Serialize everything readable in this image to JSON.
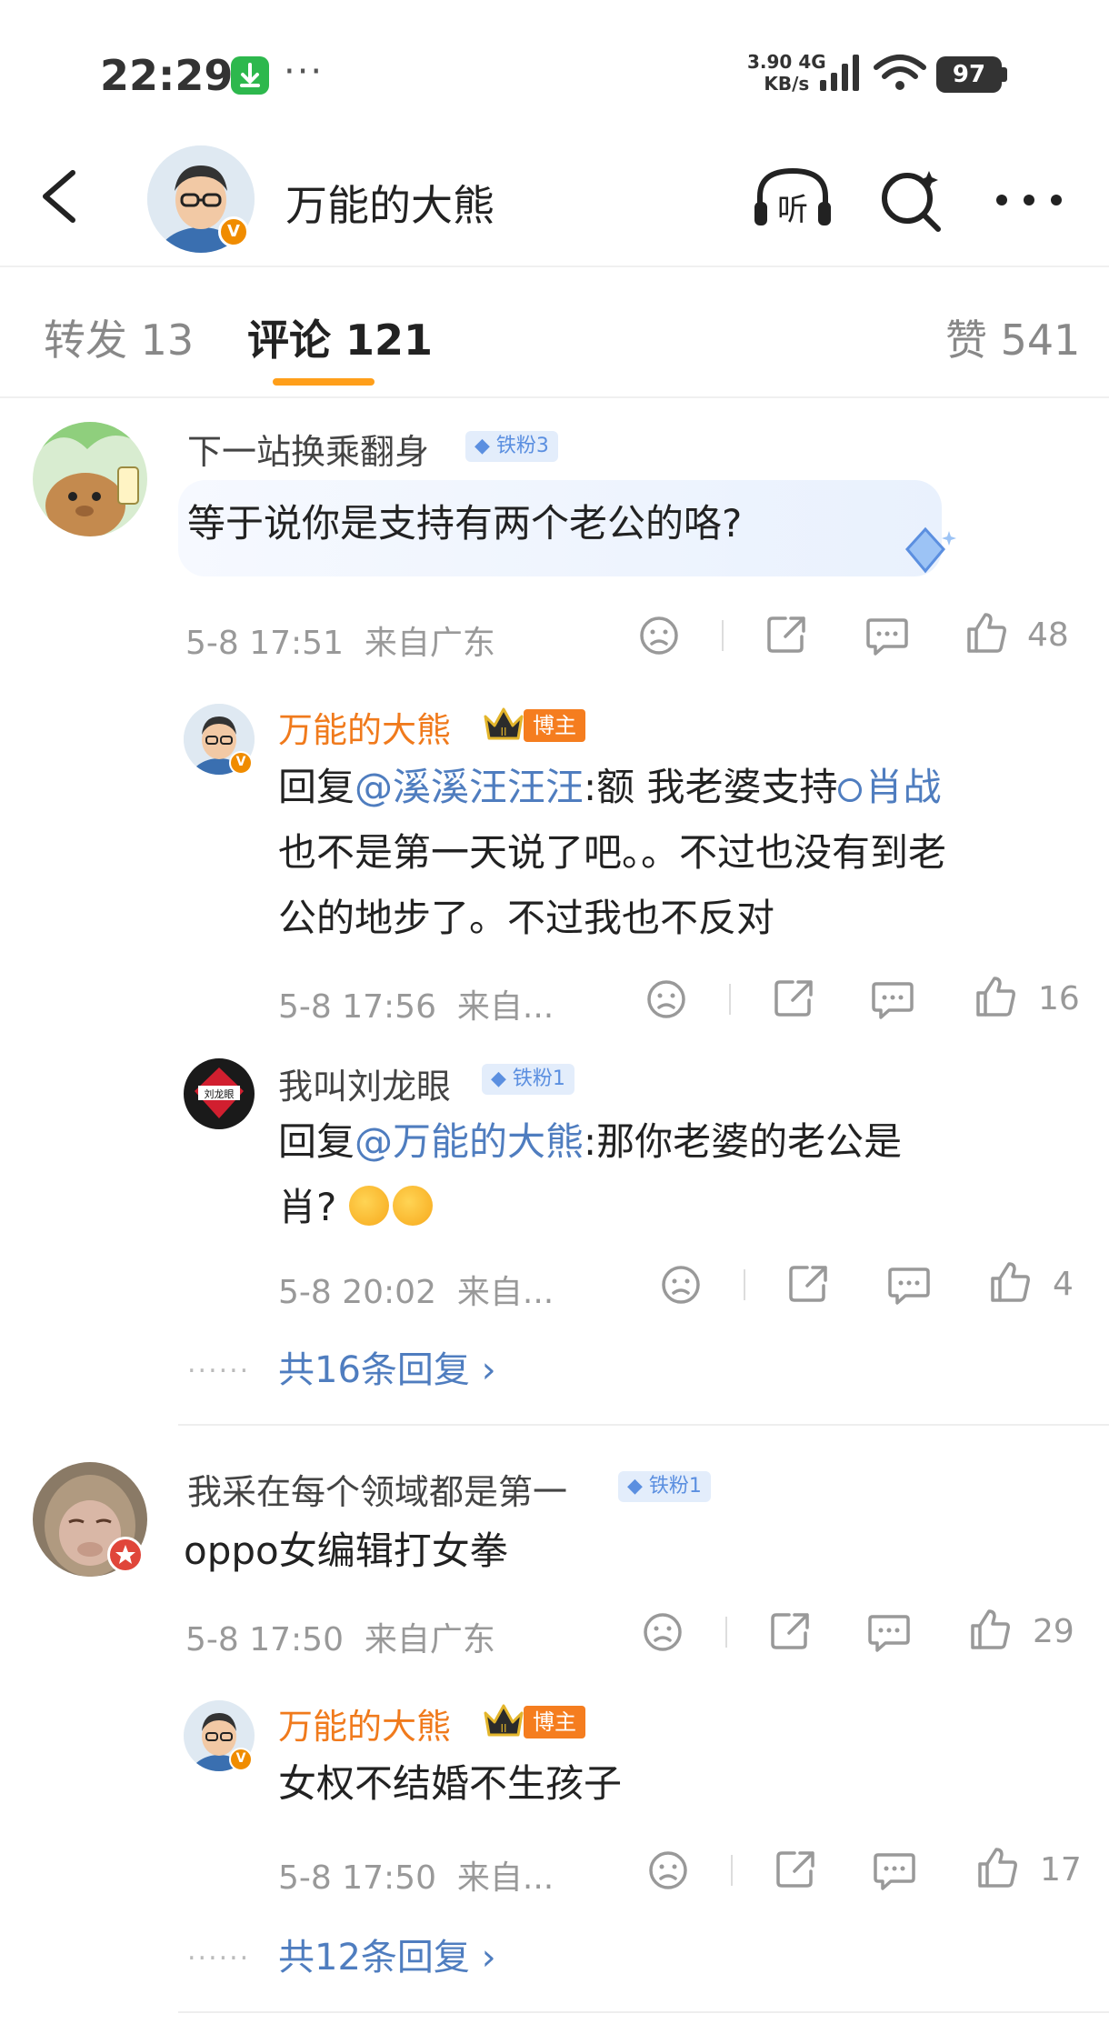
{
  "status_bar": {
    "time": "22:29",
    "more": "···",
    "net_speed_value": "3.90",
    "net_type": "4G",
    "net_unit": "KB/s",
    "battery": "97"
  },
  "header": {
    "name": "万能的大熊",
    "badge": "V",
    "listen_label": "听"
  },
  "tabs": {
    "forward": "转发 13",
    "comments": "评论 121",
    "likes": "赞 541"
  },
  "comments": [
    {
      "username": "下一站换乘翻身",
      "fan_badge": "铁粉3",
      "text": "等于说你是支持有两个老公的咯?",
      "time": "5-8 17:51",
      "location": "来自广东",
      "likes": "48",
      "replies": [
        {
          "username": "万能的大熊",
          "role_tag": "博主",
          "text_prefix": "回复",
          "mention": "@溪溪汪汪汪",
          "text_line1": ":额 我老婆支持",
          "topic": "肖战",
          "text_line2": "也不是第一天说了吧。。不过也没有到老",
          "text_line3": "公的地步了。不过我也不反对",
          "time": "5-8 17:56",
          "location": "来自...",
          "likes": "16"
        },
        {
          "username": "我叫刘龙眼",
          "fan_badge": "铁粉1",
          "avatar_text": "刘龙眼",
          "text_prefix": "回复",
          "mention": "@万能的大熊",
          "text_line1": ":那你老婆的老公是",
          "text_line2": "肖?",
          "time": "5-8 20:02",
          "location": "来自...",
          "likes": "4"
        }
      ],
      "more_replies": "共16条回复",
      "more_dots": "......"
    },
    {
      "username": "我采在每个领域都是第一",
      "fan_badge": "铁粉1",
      "text": "oppo女编辑打女拳",
      "time": "5-8 17:50",
      "location": "来自广东",
      "likes": "29",
      "replies": [
        {
          "username": "万能的大熊",
          "role_tag": "博主",
          "text": "女权不结婚不生孩子",
          "time": "5-8 17:50",
          "location": "来自...",
          "likes": "17"
        }
      ],
      "more_replies": "共12条回复",
      "more_dots": "......"
    }
  ]
}
